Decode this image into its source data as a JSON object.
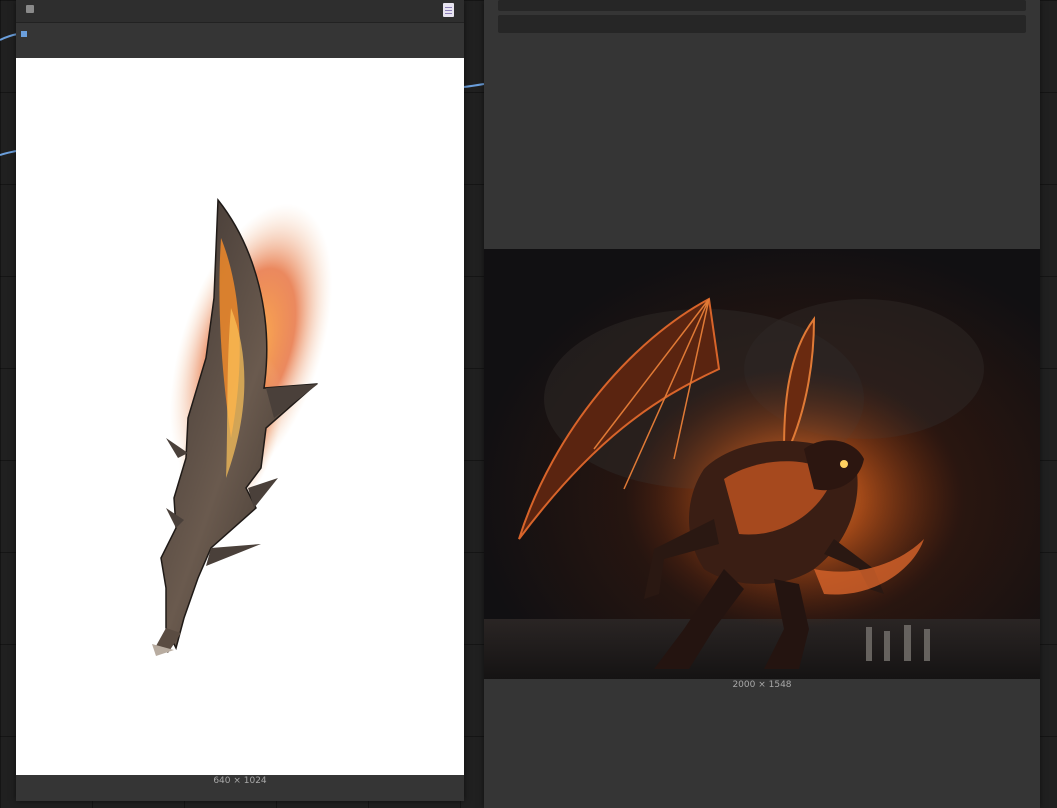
{
  "left_node": {
    "image_size": "640 × 1024",
    "image_subject": "flaming-sword"
  },
  "right_node": {
    "image_size": "2000 × 1548",
    "image_subject": "fire-dragon"
  },
  "colors": {
    "canvas": "#202020",
    "node_body": "#353535",
    "node_title": "#2e2e2e",
    "widget": "#262626",
    "link": "#6b9fdc",
    "label": "#a8a8a8"
  }
}
